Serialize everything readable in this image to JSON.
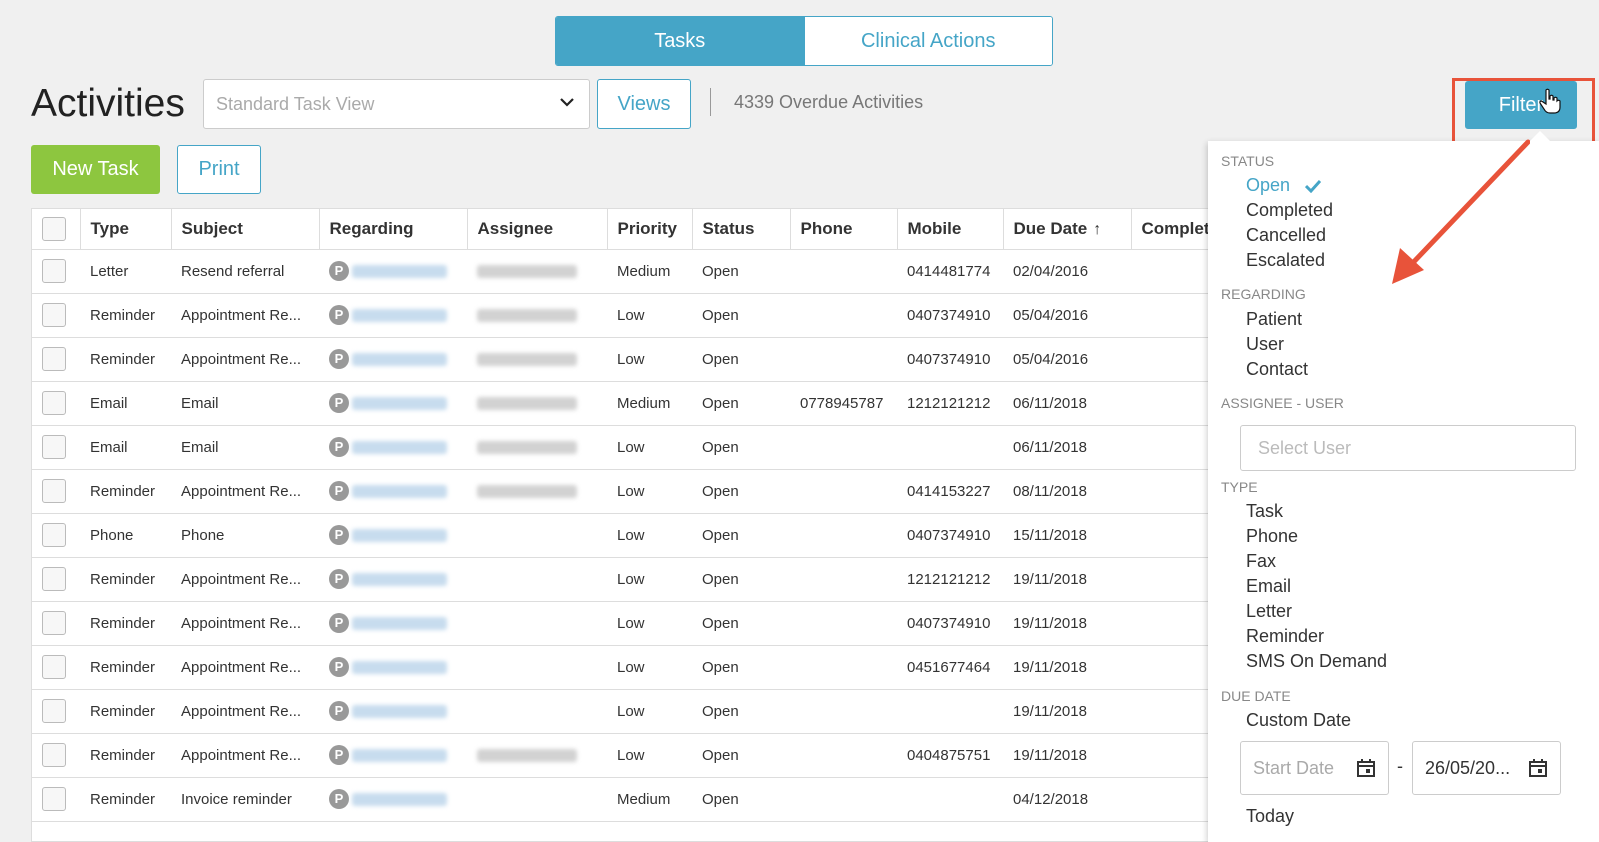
{
  "tabs": [
    {
      "label": "Tasks",
      "active": true
    },
    {
      "label": "Clinical Actions",
      "active": false
    }
  ],
  "page_title": "Activities",
  "view_select": {
    "placeholder": "Standard Task View"
  },
  "views_label": "Views",
  "overdue_text": "4339 Overdue Activities",
  "filter_label": "Filter",
  "new_task_label": "New Task",
  "print_label": "Print",
  "colors": {
    "accent": "#45a5c7",
    "green": "#8dc63f",
    "highlight": "#e8533a",
    "priority_low": "#4c9a2a",
    "priority_medium": "#f09a2e"
  },
  "table": {
    "columns": [
      "Type",
      "Subject",
      "Regarding",
      "Assignee",
      "Priority",
      "Status",
      "Phone",
      "Mobile",
      "Due Date",
      "Completed"
    ],
    "sorted_column": "Due Date",
    "rows": [
      {
        "type": "Letter",
        "subject": "Resend referral",
        "priority": "Medium",
        "status": "Open",
        "phone": "",
        "mobile": "0414481774",
        "due": "02/04/2016"
      },
      {
        "type": "Reminder",
        "subject": "Appointment Re...",
        "priority": "Low",
        "status": "Open",
        "phone": "",
        "mobile": "0407374910",
        "due": "05/04/2016"
      },
      {
        "type": "Reminder",
        "subject": "Appointment Re...",
        "priority": "Low",
        "status": "Open",
        "phone": "",
        "mobile": "0407374910",
        "due": "05/04/2016"
      },
      {
        "type": "Email",
        "subject": "Email",
        "priority": "Medium",
        "status": "Open",
        "phone": "0778945787",
        "mobile": "1212121212",
        "due": "06/11/2018"
      },
      {
        "type": "Email",
        "subject": "Email",
        "priority": "Low",
        "status": "Open",
        "phone": "",
        "mobile": "",
        "due": "06/11/2018"
      },
      {
        "type": "Reminder",
        "subject": "Appointment Re...",
        "priority": "Low",
        "status": "Open",
        "phone": "",
        "mobile": "0414153227",
        "due": "08/11/2018"
      },
      {
        "type": "Phone",
        "subject": "Phone",
        "priority": "Low",
        "status": "Open",
        "phone": "",
        "mobile": "0407374910",
        "due": "15/11/2018"
      },
      {
        "type": "Reminder",
        "subject": "Appointment Re...",
        "priority": "Low",
        "status": "Open",
        "phone": "",
        "mobile": "1212121212",
        "due": "19/11/2018"
      },
      {
        "type": "Reminder",
        "subject": "Appointment Re...",
        "priority": "Low",
        "status": "Open",
        "phone": "",
        "mobile": "0407374910",
        "due": "19/11/2018"
      },
      {
        "type": "Reminder",
        "subject": "Appointment Re...",
        "priority": "Low",
        "status": "Open",
        "phone": "",
        "mobile": "0451677464",
        "due": "19/11/2018"
      },
      {
        "type": "Reminder",
        "subject": "Appointment Re...",
        "priority": "Low",
        "status": "Open",
        "phone": "",
        "mobile": "",
        "due": "19/11/2018"
      },
      {
        "type": "Reminder",
        "subject": "Appointment Re...",
        "priority": "Low",
        "status": "Open",
        "phone": "",
        "mobile": "0404875751",
        "due": "19/11/2018"
      },
      {
        "type": "Reminder",
        "subject": "Invoice reminder",
        "priority": "Medium",
        "status": "Open",
        "phone": "",
        "mobile": "",
        "due": "04/12/2018"
      }
    ]
  },
  "filter_panel": {
    "status": {
      "heading": "STATUS",
      "options": [
        "Open",
        "Completed",
        "Cancelled",
        "Escalated"
      ],
      "selected": "Open"
    },
    "regarding": {
      "heading": "REGARDING",
      "options": [
        "Patient",
        "User",
        "Contact"
      ]
    },
    "assignee": {
      "heading": "ASSIGNEE - USER",
      "placeholder": "Select User"
    },
    "type": {
      "heading": "TYPE",
      "options": [
        "Task",
        "Phone",
        "Fax",
        "Email",
        "Letter",
        "Reminder",
        "SMS On Demand"
      ]
    },
    "due_date": {
      "heading": "DUE DATE",
      "custom_label": "Custom Date",
      "start_placeholder": "Start Date",
      "separator": "-",
      "end_value": "26/05/20...",
      "today_label": "Today"
    }
  },
  "icons": {
    "dropdown": "chevron-down-icon",
    "calendar": "calendar-icon",
    "check": "check-icon",
    "cursor": "hand-cursor-icon",
    "regarding": "patient-badge-icon"
  }
}
